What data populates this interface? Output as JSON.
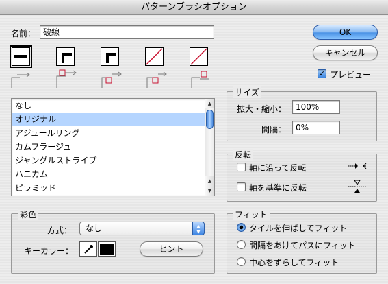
{
  "window": {
    "title": "パターンブラシオプション"
  },
  "name_field": {
    "label": "名前：",
    "value": "破線"
  },
  "buttons": {
    "ok": "OK",
    "cancel": "キャンセル",
    "hint": "ヒント"
  },
  "preview": {
    "label": "プレビュー",
    "checked": true
  },
  "tiles": [
    {
      "name": "side-tile",
      "selected": true
    },
    {
      "name": "outer-corner-tile",
      "selected": false
    },
    {
      "name": "inner-corner-tile",
      "selected": false
    },
    {
      "name": "start-tile",
      "selected": false
    },
    {
      "name": "end-tile",
      "selected": false
    }
  ],
  "pattern_list": {
    "items": [
      "なし",
      "オリジナル",
      "アジュールリング",
      "カムフラージュ",
      "ジャングルストライプ",
      "ハニカム",
      "ピラミッド"
    ],
    "selected_index": 1
  },
  "size": {
    "title": "サイズ",
    "scale_label": "拡大・縮小：",
    "scale_value": "100%",
    "spacing_label": "間隔：",
    "spacing_value": "0%"
  },
  "flip": {
    "title": "反転",
    "along_label": "軸に沿って反転",
    "across_label": "軸を基準に反転",
    "along_checked": false,
    "across_checked": false
  },
  "colorization": {
    "title": "彩色",
    "method_label": "方式：",
    "method_value": "なし",
    "key_color_label": "キーカラー："
  },
  "fit": {
    "title": "フィット",
    "options": [
      "タイルを伸ばしてフィット",
      "間隔をあけてパスにフィット",
      "中心をずらしてフィット"
    ],
    "selected_index": 0
  },
  "colors": {
    "accent": "#3d86e0",
    "selection": "#b5d5ff",
    "tile_red": "#c8102e"
  }
}
